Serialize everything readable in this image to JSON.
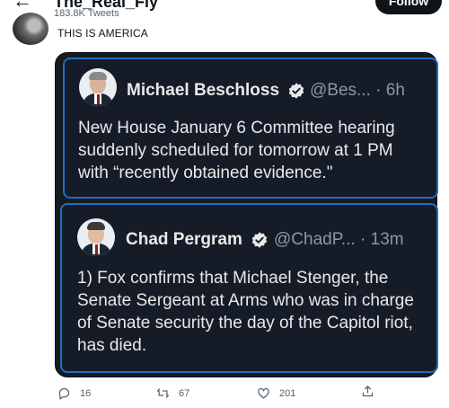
{
  "header": {
    "account_name": "The_Real_Fly",
    "tweet_count": "183.8K Tweets",
    "follow_label": "Follow"
  },
  "tweet": {
    "text": "THIS IS AMERICA"
  },
  "quotes": [
    {
      "name": "Michael Beschloss",
      "handle": "@Bes...",
      "time": "6h",
      "body": "New House January 6 Committee hearing suddenly scheduled for tomorrow at 1 PM with “recently obtained evidence.\""
    },
    {
      "name": "Chad Pergram",
      "handle": "@ChadP...",
      "time": "13m",
      "body": "1) Fox confirms that Michael Stenger, the Senate Sergeant at Arms who was in charge of Senate security the day of the Capitol riot, has died."
    }
  ],
  "actions": {
    "replies": "16",
    "retweets": "67",
    "likes": "201"
  },
  "colors": {
    "card_border": "#1b6fc4",
    "card_bg": "#161c27",
    "verified": "#e7e9ea"
  }
}
